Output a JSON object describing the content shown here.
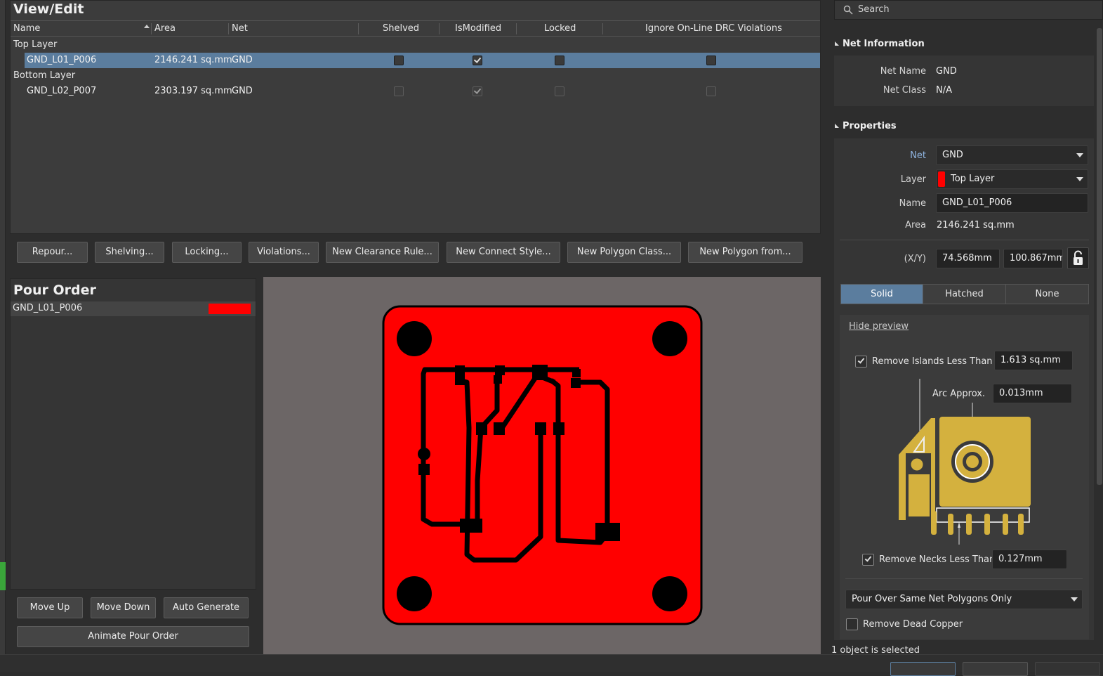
{
  "view_edit": {
    "title": "View/Edit",
    "columns": [
      "Name",
      "Area",
      "Net",
      "Shelved",
      "IsModified",
      "Locked",
      "Ignore On-Line DRC Violations"
    ],
    "groups": [
      {
        "label": "Top Layer",
        "rows": [
          {
            "name": "GND_L01_P006",
            "area": "2146.241 sq.mm",
            "net": "GND",
            "shelved": false,
            "is_modified": true,
            "locked": false,
            "ignore_drc": false,
            "selected": true
          }
        ]
      },
      {
        "label": "Bottom Layer",
        "rows": [
          {
            "name": "GND_L02_P007",
            "area": "2303.197 sq.mm",
            "net": "GND",
            "shelved": false,
            "is_modified": true,
            "locked": false,
            "ignore_drc": false,
            "selected": false
          }
        ]
      }
    ]
  },
  "actions": [
    "Repour...",
    "Shelving...",
    "Locking...",
    "Violations...",
    "New Clearance Rule...",
    "New Connect Style...",
    "New Polygon Class...",
    "New Polygon from..."
  ],
  "pour_order": {
    "title": "Pour Order",
    "items": [
      {
        "name": "GND_L01_P006",
        "color": "#ff0000"
      }
    ],
    "buttons": {
      "move_up": "Move Up",
      "move_down": "Move Down",
      "auto_generate": "Auto Generate",
      "animate": "Animate Pour Order"
    }
  },
  "preview": {
    "board_color": "#ff0000",
    "background": "#6c6666"
  },
  "inspector": {
    "search_placeholder": "Search",
    "net_info": {
      "title": "Net Information",
      "net_name_label": "Net Name",
      "net_name": "GND",
      "net_class_label": "Net Class",
      "net_class": "N/A"
    },
    "properties": {
      "title": "Properties",
      "net_label": "Net",
      "net": "GND",
      "layer_label": "Layer",
      "layer": "Top Layer",
      "layer_color": "#ff0000",
      "name_label": "Name",
      "name": "GND_L01_P006",
      "area_label": "Area",
      "area": "2146.241 sq.mm",
      "xy_label": "(X/Y)",
      "x": "74.568mm",
      "y": "100.867mm"
    },
    "fill_modes": [
      "Solid",
      "Hatched",
      "None"
    ],
    "active_fill_mode": "Solid",
    "hide_preview": "Hide preview",
    "remove_islands": {
      "label": "Remove Islands Less Than",
      "value": "1.613 sq.mm",
      "checked": true
    },
    "arc_approx": {
      "label": "Arc Approx.",
      "value": "0.013mm"
    },
    "remove_necks": {
      "label": "Remove Necks Less Than",
      "value": "0.127mm",
      "checked": true
    },
    "pour_over": "Pour Over Same Net Polygons Only",
    "remove_dead_copper": {
      "label": "Remove Dead Copper",
      "checked": false
    },
    "status": "1 object is selected"
  }
}
